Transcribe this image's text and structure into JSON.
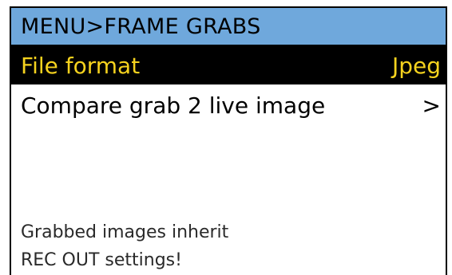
{
  "header": {
    "title": "MENU>FRAME GRABS"
  },
  "colors": {
    "header_bg": "#6fa8dc",
    "selected_bg": "#000000",
    "selected_text": "#f5d21e",
    "text": "#000000"
  },
  "menu": {
    "items": [
      {
        "label": "File format",
        "value": "Jpeg",
        "selected": true
      },
      {
        "label": "Compare grab 2 live image",
        "value": ">",
        "value_icon": "chevron-right-icon",
        "selected": false
      }
    ]
  },
  "footer": {
    "line1": "Grabbed images inherit",
    "line2": "REC OUT settings!"
  }
}
